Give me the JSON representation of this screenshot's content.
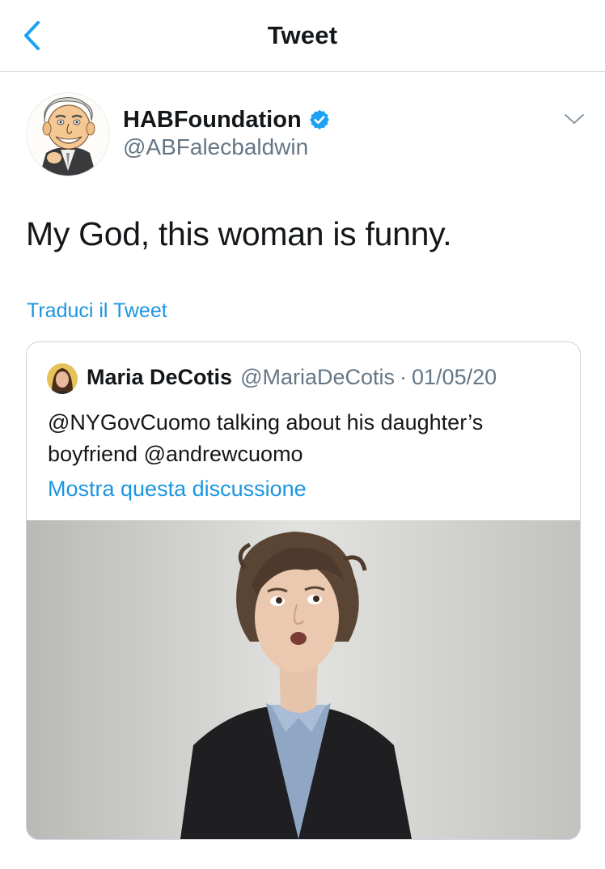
{
  "header": {
    "back_icon": "chevron-left-icon",
    "title": "Tweet"
  },
  "tweet": {
    "author": {
      "name": "HABFoundation",
      "handle": "@ABFalecbaldwin",
      "verified": true,
      "avatar_icon": "caricature-avatar"
    },
    "menu_icon": "chevron-down-icon",
    "text": "My God, this woman is funny.",
    "translate_label": "Traduci il Tweet"
  },
  "quoted_tweet": {
    "author_name": "Maria DeCotis",
    "author_handle": "@MariaDeCotis",
    "separator": "·",
    "date": "01/05/20",
    "text": "@NYGovCuomo talking about his daughter’s boyfriend @andrewcuomo",
    "thread_link": "Mostra questa discussione",
    "media": "video-thumbnail"
  },
  "colors": {
    "accent": "#1b95e0",
    "text_primary": "#14171a",
    "text_secondary": "#657786",
    "border": "#ccd6dd",
    "verified": "#1da1f2"
  }
}
